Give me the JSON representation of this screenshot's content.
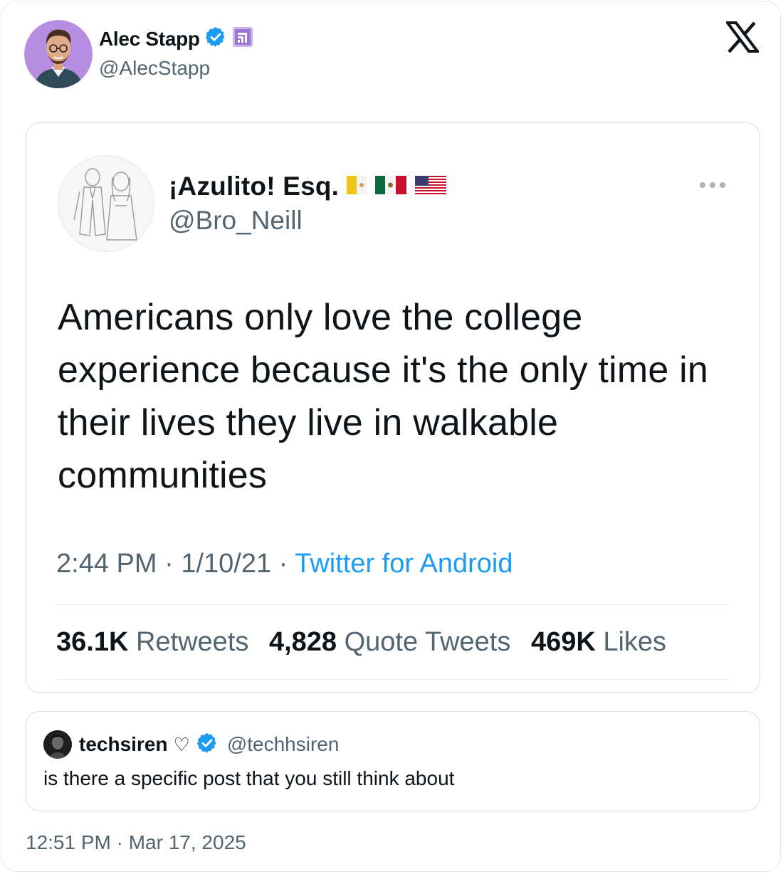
{
  "author": {
    "name": "Alec Stapp",
    "handle": "@AlecStapp"
  },
  "quoted_screenshot": {
    "name": "¡Azulito! Esq.",
    "handle": "@Bro_Neill",
    "text": "Americans only love the college experience because it's the only time in their lives they live in walkable communities",
    "time": "2:44 PM",
    "date": "1/10/21",
    "separator": " · ",
    "source": "Twitter for Android",
    "stats": {
      "retweets_count": "36.1K",
      "retweets_label": "Retweets",
      "quotes_count": "4,828",
      "quotes_label": "Quote Tweets",
      "likes_count": "469K",
      "likes_label": "Likes"
    }
  },
  "reply": {
    "name": "techsiren",
    "emoji": "♡",
    "handle": "@techhsiren",
    "text": "is there a specific post that you still think about"
  },
  "timestamp": "12:51 PM · Mar 17, 2025",
  "colors": {
    "verified": "#1d9bf0",
    "link": "#1d9bf0",
    "secondary_text": "#536471",
    "primary_text": "#0f1419",
    "avatar_bg": "#b68de0"
  }
}
